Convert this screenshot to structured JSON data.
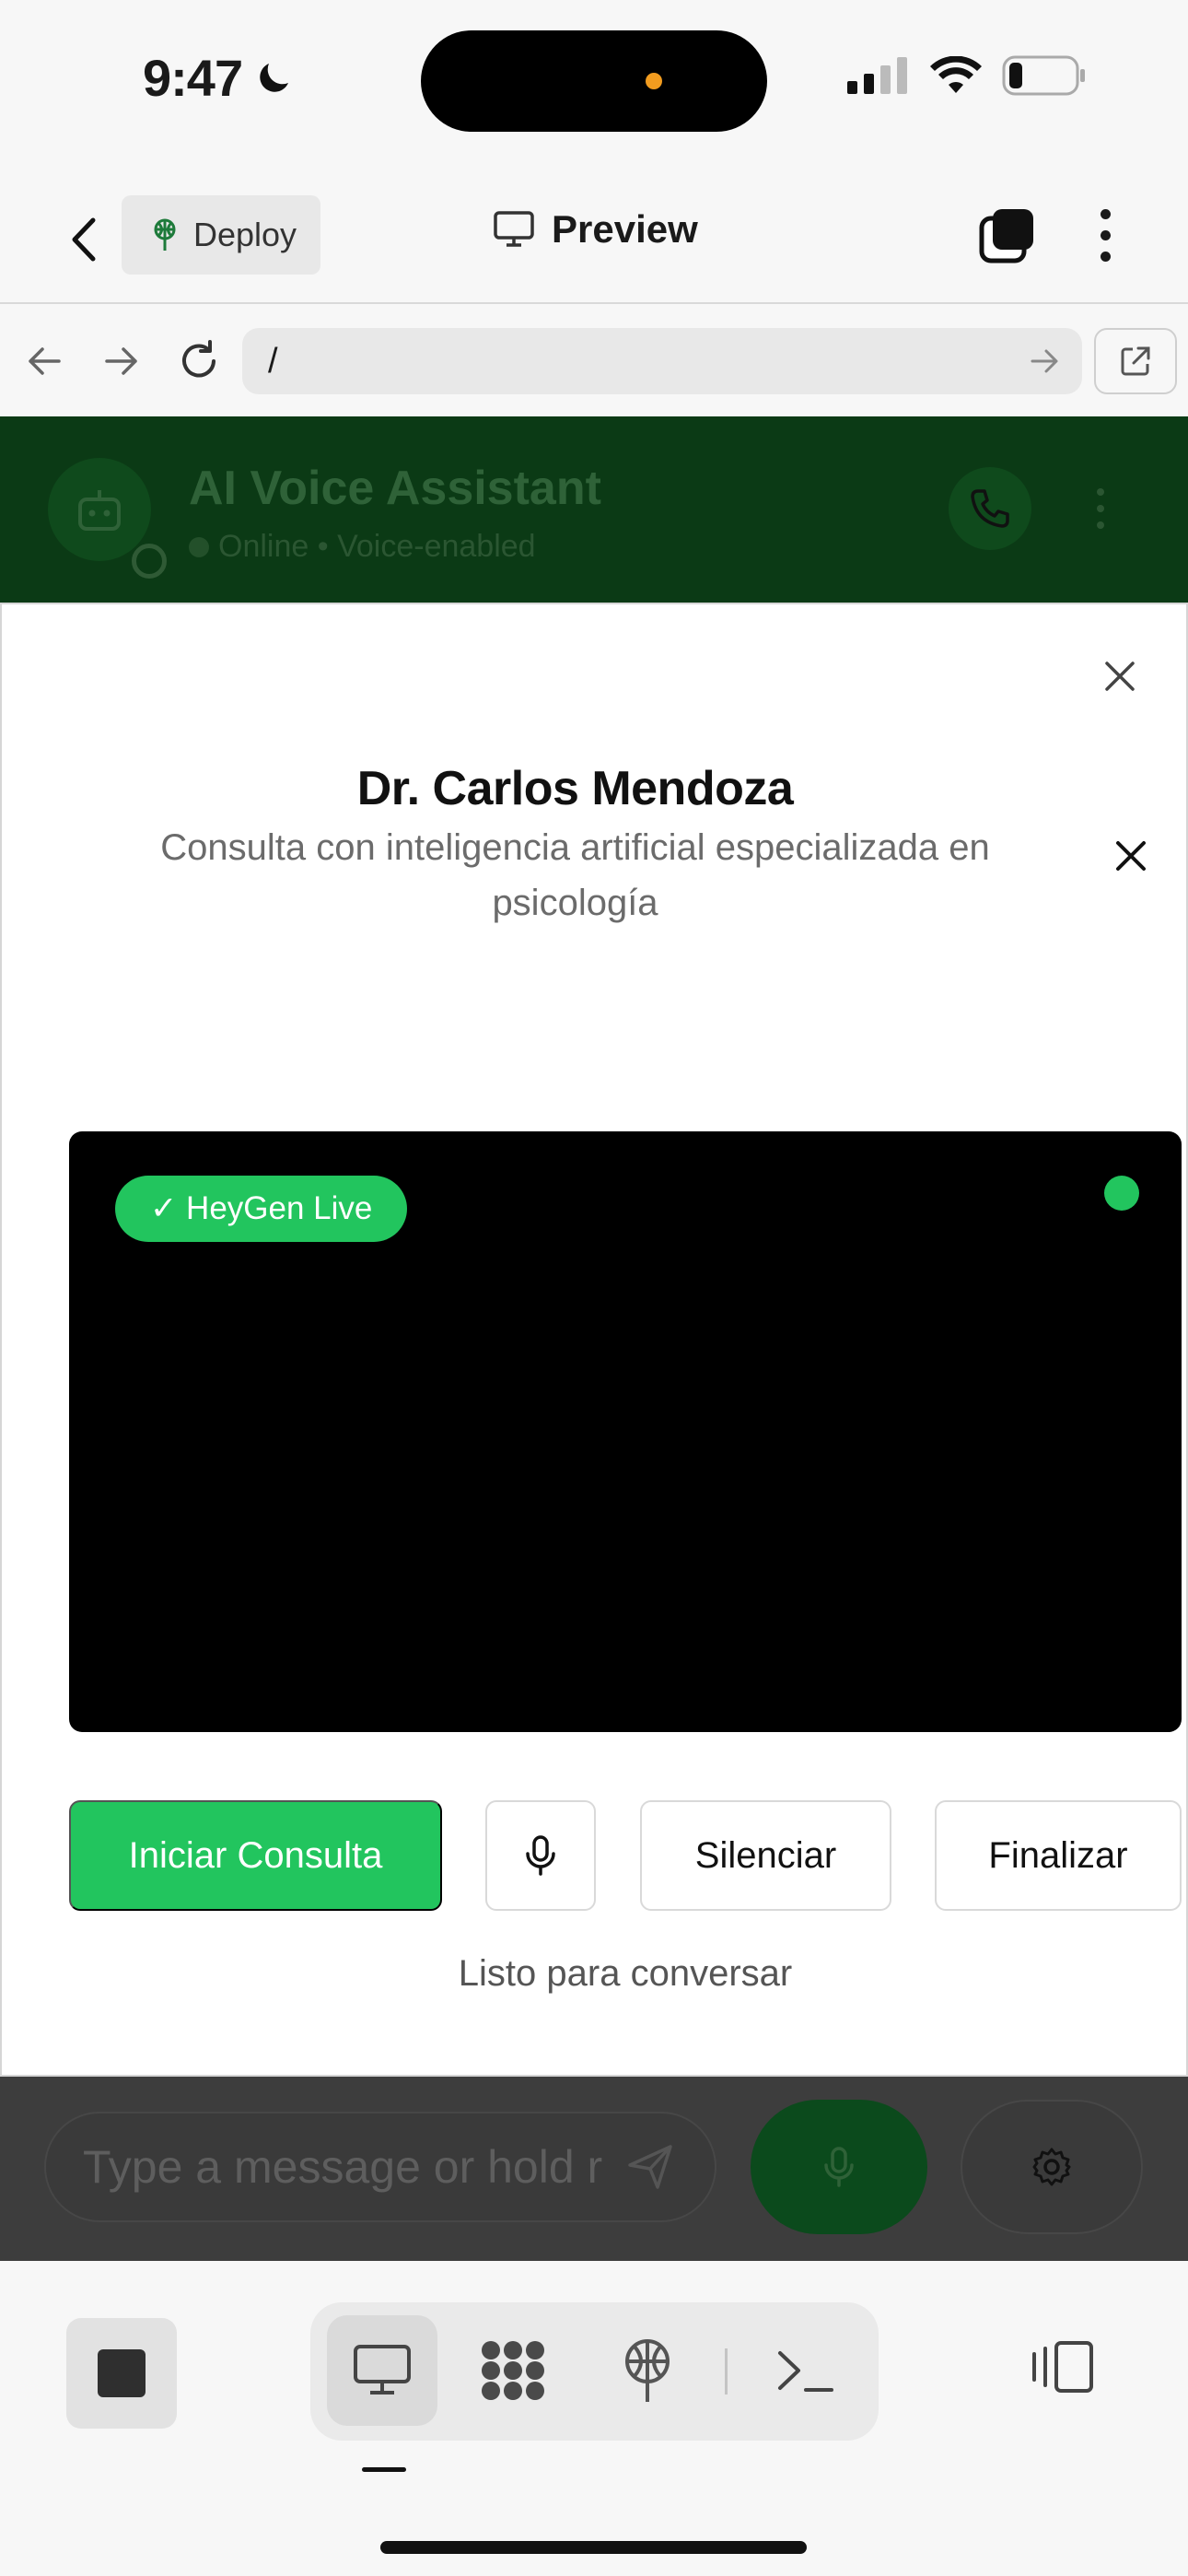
{
  "status_bar": {
    "time": "9:47",
    "icons": [
      "moon-icon",
      "signal-icon",
      "wifi-icon",
      "battery-icon"
    ]
  },
  "toolbar": {
    "back_icon": "chevron-left-icon",
    "deploy_label": "Deploy",
    "preview_label": "Preview",
    "tabs_icon": "tabs-icon",
    "more_icon": "more-vertical-icon"
  },
  "urlbar": {
    "url": "/",
    "icons": [
      "arrow-left-icon",
      "arrow-right-icon",
      "refresh-icon",
      "arrow-go-icon",
      "external-link-icon"
    ]
  },
  "app_header": {
    "title": "AI Voice Assistant",
    "status": "Online • Voice-enabled"
  },
  "modal": {
    "title": "Dr. Carlos Mendoza",
    "subtitle": "Consulta con inteligencia artificial especializada en psicología",
    "live_badge": "✓ HeyGen Live",
    "buttons": {
      "start": "Iniciar Consulta",
      "mute": "Silenciar",
      "end": "Finalizar"
    },
    "status": "Listo para conversar"
  },
  "chat": {
    "placeholder": "Type a message or hold r"
  },
  "colors": {
    "accent_green": "#22c55e",
    "header_dim_green": "#0b3a15",
    "overlay_gray": "#3d3d3d"
  }
}
